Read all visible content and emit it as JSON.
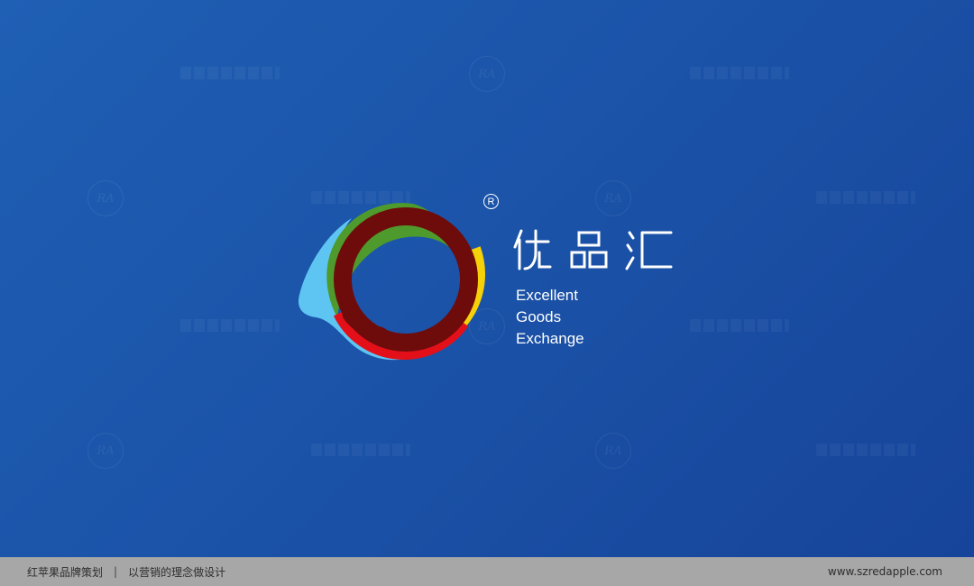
{
  "logo": {
    "registered_symbol": "R",
    "name_cn": "优品汇",
    "name_en_lines": [
      "Excellent",
      "Goods",
      "Exchange"
    ],
    "colors": {
      "background": "#1c56ab",
      "ring_yellow": "#f5d10a",
      "ring_green": "#4e9a2c",
      "ring_sky": "#5ec4f2",
      "ring_red": "#e3101a",
      "ring_maroon": "#6e0b0b"
    }
  },
  "watermark": {
    "emblem": "RA",
    "text": "红苹果品牌策划"
  },
  "footer": {
    "company": "红苹果品牌策划",
    "separator": "|",
    "slogan": "以营销的理念做设计",
    "website": "www.szredapple.com"
  }
}
